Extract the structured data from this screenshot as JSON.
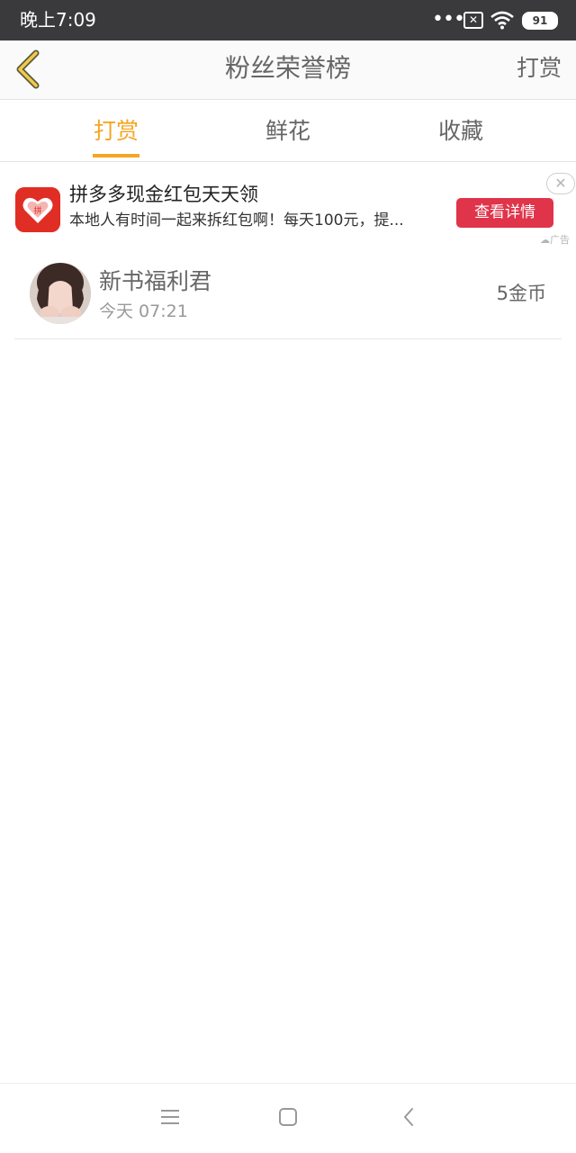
{
  "status_bar": {
    "time": "晚上7:09",
    "dots": "•••",
    "battery": "91",
    "icons": [
      "more-dots-icon",
      "sim-x-icon",
      "wifi-icon",
      "battery-icon"
    ]
  },
  "nav": {
    "back_icon": "chevron-left-icon",
    "title": "粉丝荣誉榜",
    "action_label": "打赏"
  },
  "tabs": [
    {
      "label": "打赏",
      "active": true
    },
    {
      "label": "鲜花",
      "active": false
    },
    {
      "label": "收藏",
      "active": false
    }
  ],
  "ad": {
    "title": "拼多多现金红包天天领",
    "description": "本地人有时间一起来拆红包啊！每天100元，提...",
    "button_label": "查看详情",
    "close_glyph": "✕",
    "tag": "广告",
    "logo_icon": "pinduoduo-logo-icon"
  },
  "list": [
    {
      "name": "新书福利君",
      "time": "今天 07:21",
      "amount": "5金币"
    }
  ],
  "bottom_nav": {
    "icons": [
      "menu-icon",
      "home-square-icon",
      "back-chevron-icon"
    ]
  },
  "colors": {
    "accent": "#f5a623",
    "status_bar_bg": "#3a3a3c",
    "ad_button": "#e0344a",
    "ad_logo": "#e02e24"
  }
}
